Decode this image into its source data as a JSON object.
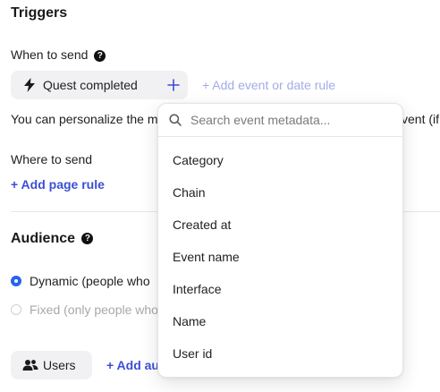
{
  "triggers": {
    "title": "Triggers",
    "when_label": "When to send",
    "help_glyph": "?",
    "event_chip": "Quest completed",
    "add_event_label": "+ Add event or date rule",
    "personalize_text_left": "You can personalize the m",
    "personalize_text_right": "vent (if",
    "where_label": "Where to send",
    "add_page_rule_label": "+ Add page rule"
  },
  "audience": {
    "title": "Audience",
    "help_glyph": "?",
    "dynamic_label": "Dynamic (people who",
    "fixed_label": "Fixed (only people who",
    "dynamic_selected": true,
    "users_chip": "Users",
    "add_label": "+ Add au"
  },
  "dropdown": {
    "search_placeholder": "Search event metadata...",
    "options": [
      "Category",
      "Chain",
      "Created at",
      "Event name",
      "Interface",
      "Name",
      "User id"
    ]
  },
  "colors": {
    "accent": "#3b4fd4",
    "radio_selected": "#2563eb",
    "chip_bg": "#f1f1f3"
  },
  "icons": {
    "event": "lightning-bolt-icon",
    "add": "plus-icon",
    "search": "search-icon",
    "users": "users-icon"
  }
}
